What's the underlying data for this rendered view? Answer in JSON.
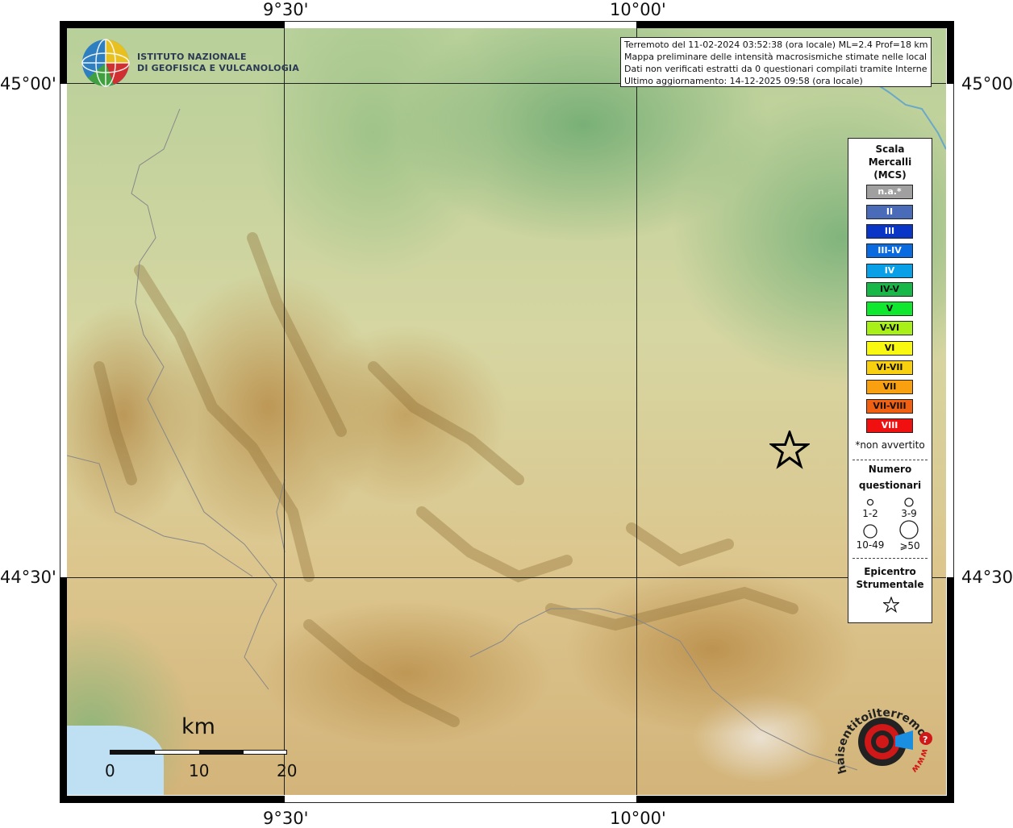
{
  "axes": {
    "top_labels": [
      "9°30'",
      "10°00'"
    ],
    "bottom_labels": [
      "9°30'",
      "10°00'"
    ],
    "left_labels": [
      "45°00'",
      "44°30'"
    ],
    "right_labels": [
      "45°00'",
      "44°30'"
    ]
  },
  "logo": {
    "line1": "ISTITUTO NAZIONALE",
    "line2": "DI GEOFISICA E VULCANOLOGIA"
  },
  "info": {
    "line1": "Terremoto del 11-02-2024 03:52:38 (ora locale) ML=2.4 Prof=18 km",
    "line2": "Mappa preliminare delle intensità macrosismiche stimate nelle località",
    "line3": "Dati non verificati estratti da 0 questionari compilati tramite Internet.",
    "line4": "Ultimo aggiornamento: 14-12-2025 09:58 (ora locale)"
  },
  "legend": {
    "title1": "Scala",
    "title2": "Mercalli",
    "title3": "(MCS)",
    "scale": [
      {
        "label": "n.a.*",
        "color": "#a0a0a0",
        "text_color": "#ffffff"
      },
      {
        "label": "II",
        "color": "#4a6cb8",
        "text_color": "#ffffff"
      },
      {
        "label": "III",
        "color": "#0a36c8",
        "text_color": "#ffffff"
      },
      {
        "label": "III-IV",
        "color": "#0a6adf",
        "text_color": "#ffffff"
      },
      {
        "label": "IV",
        "color": "#0aa0e8",
        "text_color": "#ffffff"
      },
      {
        "label": "IV-V",
        "color": "#18b848",
        "text_color": "#111111"
      },
      {
        "label": "V",
        "color": "#10e830",
        "text_color": "#111111"
      },
      {
        "label": "V-VI",
        "color": "#a8f018",
        "text_color": "#111111"
      },
      {
        "label": "VI",
        "color": "#f8f810",
        "text_color": "#111111"
      },
      {
        "label": "VI-VII",
        "color": "#f8d010",
        "text_color": "#111111"
      },
      {
        "label": "VII",
        "color": "#f8a010",
        "text_color": "#111111"
      },
      {
        "label": "VII-VIII",
        "color": "#f06010",
        "text_color": "#111111"
      },
      {
        "label": "VIII",
        "color": "#f01010",
        "text_color": "#ffffff"
      }
    ],
    "not_felt": "*non avvertito",
    "count_title1": "Numero",
    "count_title2": "questionari",
    "counts": [
      "1-2",
      "3-9",
      "10-49",
      "⩾50"
    ],
    "epicenter_title1": "Epicentro",
    "epicenter_title2": "Strumentale"
  },
  "scalebar": {
    "unit": "km",
    "ticks": [
      "0",
      "10",
      "20"
    ]
  },
  "hsi_logo": {
    "text": "haisentitoilterremoto.it",
    "url": "www"
  }
}
